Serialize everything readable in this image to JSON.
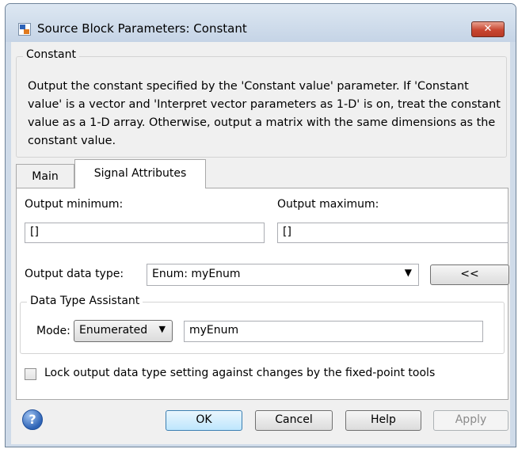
{
  "window": {
    "title": "Source Block Parameters: Constant",
    "close_glyph": "✕"
  },
  "block": {
    "name": "Constant",
    "description": "Output the constant specified by the 'Constant value' parameter. If 'Constant value' is a vector and 'Interpret vector parameters as 1-D' is on, treat the constant value as a 1-D array. Otherwise, output a matrix with the same dimensions as the constant value."
  },
  "tabs": [
    {
      "label": "Main",
      "active": false
    },
    {
      "label": "Signal Attributes",
      "active": true
    }
  ],
  "signal_attributes": {
    "output_minimum_label": "Output minimum:",
    "output_minimum_value": "[]",
    "output_maximum_label": "Output maximum:",
    "output_maximum_value": "[]",
    "output_data_type_label": "Output data type:",
    "output_data_type_value": "Enum: myEnum",
    "assistant_toggle_label": "<<",
    "assistant": {
      "title": "Data Type Assistant",
      "mode_label": "Mode:",
      "mode_value": "Enumerated",
      "enum_name_value": "myEnum"
    },
    "lock_checkbox_label": "Lock output data type setting against changes by the fixed-point tools",
    "lock_checked": false
  },
  "buttons": {
    "help_icon_glyph": "?",
    "ok": "OK",
    "cancel": "Cancel",
    "help": "Help",
    "apply": "Apply"
  },
  "colors": {
    "window_frame": "#cfdbe9",
    "dialog_bg": "#f0f0f0",
    "close_button": "#c84631",
    "ok_highlight": "#3c7fb1"
  },
  "icons": [
    "simulink-block-icon",
    "close-icon",
    "dropdown-arrow-icon",
    "help-icon"
  ]
}
